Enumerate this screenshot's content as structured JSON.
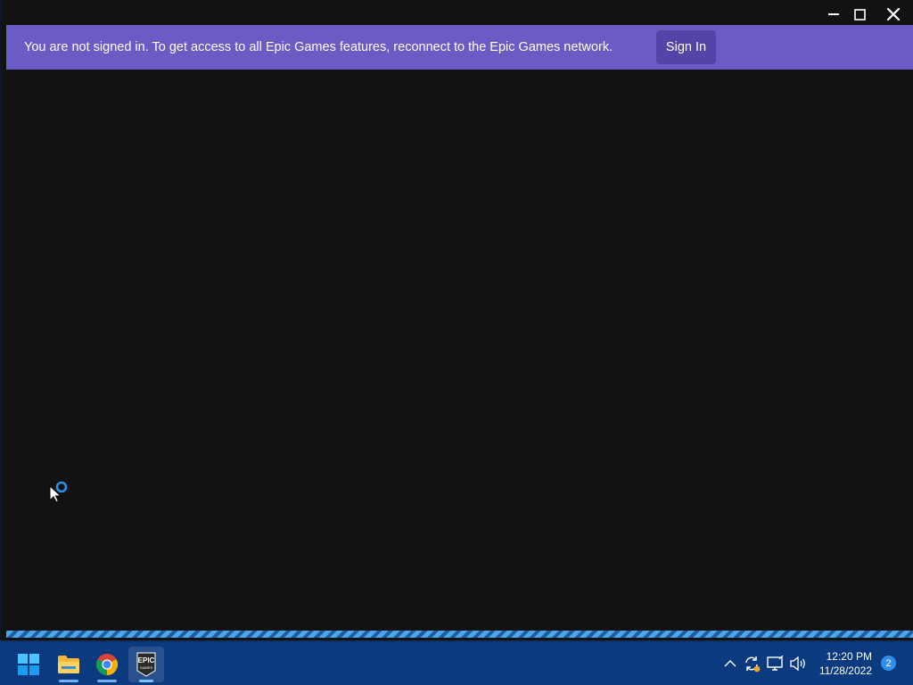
{
  "window": {
    "controls": {
      "minimize_icon": "minimize-icon",
      "maximize_icon": "maximize-icon",
      "close_icon": "close-icon"
    }
  },
  "banner": {
    "message": "You are not signed in. To get access to all Epic Games features, reconnect to the Epic Games network.",
    "sign_in_label": "Sign In",
    "color": "#6b5cc5",
    "button_color": "#5344a8"
  },
  "loading": {
    "state": "loading",
    "cursor": "busy-cursor-icon"
  },
  "taskbar": {
    "apps": [
      {
        "name": "Start",
        "icon": "windows-start-icon"
      },
      {
        "name": "File Explorer",
        "icon": "folder-icon",
        "running": true
      },
      {
        "name": "Google Chrome",
        "icon": "chrome-icon",
        "running": true
      },
      {
        "name": "Epic Games Launcher",
        "icon": "epic-games-icon",
        "running": true,
        "active": true,
        "icon_text_top": "EPIC",
        "icon_text_bottom": "GAMES"
      }
    ],
    "tray": {
      "icons": [
        "chevron-up-icon",
        "sync-icon",
        "network-icon",
        "volume-icon"
      ]
    },
    "clock": {
      "time": "12:20 PM",
      "date": "11/28/2022"
    },
    "notification_count": "2",
    "color": "#0b3a7e"
  },
  "colors": {
    "app_background": "#121212",
    "accent": "#4aa6ee"
  }
}
